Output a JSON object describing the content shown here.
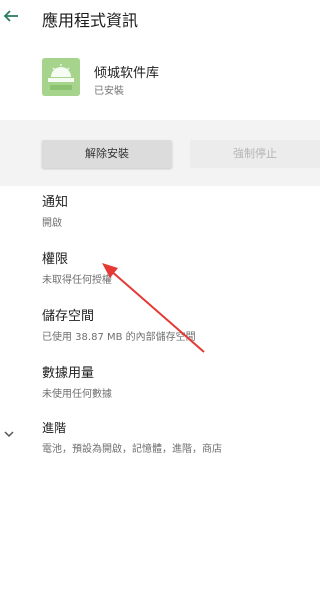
{
  "appbar": {
    "back_icon": "arrow-back-icon",
    "title": "應用程式資訊"
  },
  "app": {
    "icon": "app-logo-icon",
    "name": "倾城软件库",
    "status": "已安裝"
  },
  "actions": {
    "uninstall_label": "解除安裝",
    "force_stop_label": "強制停止"
  },
  "preferences": [
    {
      "title": "通知",
      "summary": "開啟"
    },
    {
      "title": "權限",
      "summary": "未取得任何授權"
    },
    {
      "title": "儲存空間",
      "summary": "已使用 38.87 MB 的內部儲存空間"
    },
    {
      "title": "數據用量",
      "summary": "未使用任何數據"
    },
    {
      "title": "進階",
      "summary": "電池，預設為開啟，記憶體，進階，商店"
    }
  ],
  "advanced_expand_icon": "chevron-down-icon",
  "annotation": {
    "color": "#e53935"
  }
}
